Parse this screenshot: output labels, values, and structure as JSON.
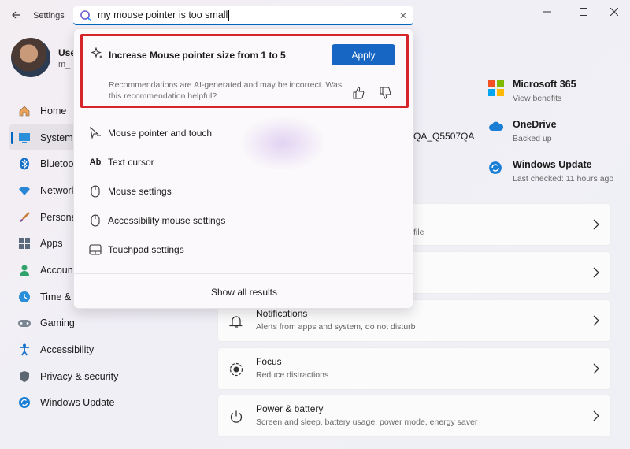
{
  "window": {
    "title": "Settings",
    "back_icon": "arrow-left-icon",
    "minimize_icon": "minimize-icon",
    "maximize_icon": "maximize-icon",
    "close_icon": "close-icon"
  },
  "profile": {
    "name": "Use",
    "email": "m_"
  },
  "search": {
    "query": "my mouse pointer is too small",
    "clear_icon": "✕"
  },
  "recommendation": {
    "title": "Increase Mouse pointer size from 1 to 5",
    "apply_label": "Apply",
    "note": "Recommendations are AI-generated and may be incorrect. Was this recommendation helpful?"
  },
  "results": [
    {
      "label": "Mouse pointer and touch",
      "icon": "mouse-pointer-icon"
    },
    {
      "label": "Text cursor",
      "icon": "text-cursor-icon",
      "glyph": "Ab"
    },
    {
      "label": "Mouse settings",
      "icon": "mouse-icon"
    },
    {
      "label": "Accessibility mouse settings",
      "icon": "mouse-icon"
    },
    {
      "label": "Touchpad settings",
      "icon": "touchpad-icon"
    }
  ],
  "show_all_label": "Show all results",
  "nav": [
    {
      "label": "Home",
      "icon": "home-icon"
    },
    {
      "label": "System",
      "icon": "system-icon",
      "active": true
    },
    {
      "label": "Bluetoo",
      "icon": "bluetooth-icon"
    },
    {
      "label": "Network",
      "icon": "wifi-icon"
    },
    {
      "label": "Persona",
      "icon": "brush-icon"
    },
    {
      "label": "Apps",
      "icon": "apps-icon"
    },
    {
      "label": "Account",
      "icon": "account-icon"
    },
    {
      "label": "Time &",
      "icon": "time-icon"
    },
    {
      "label": "Gaming",
      "icon": "gamepad-icon"
    },
    {
      "label": "Accessibility",
      "icon": "accessibility-icon"
    },
    {
      "label": "Privacy & security",
      "icon": "shield-icon"
    },
    {
      "label": "Windows Update",
      "icon": "update-icon"
    }
  ],
  "device_name": "QA_Q5507QA",
  "right_info": {
    "ms365": {
      "title": "Microsoft 365",
      "sub": "View benefits"
    },
    "onedrive": {
      "title": "OneDrive",
      "sub": "Backed up"
    },
    "update": {
      "title": "Windows Update",
      "sub": "Last checked: 11 hours ago"
    }
  },
  "cards": {
    "partial_text": "file",
    "notifications": {
      "title": "Notifications",
      "sub": "Alerts from apps and system, do not disturb"
    },
    "focus": {
      "title": "Focus",
      "sub": "Reduce distractions"
    },
    "power": {
      "title": "Power & battery",
      "sub": "Screen and sleep, battery usage, power mode, energy saver"
    }
  },
  "colors": {
    "accent": "#0067c0",
    "apply_button": "#1866c3",
    "highlight_border": "#d5242a"
  }
}
